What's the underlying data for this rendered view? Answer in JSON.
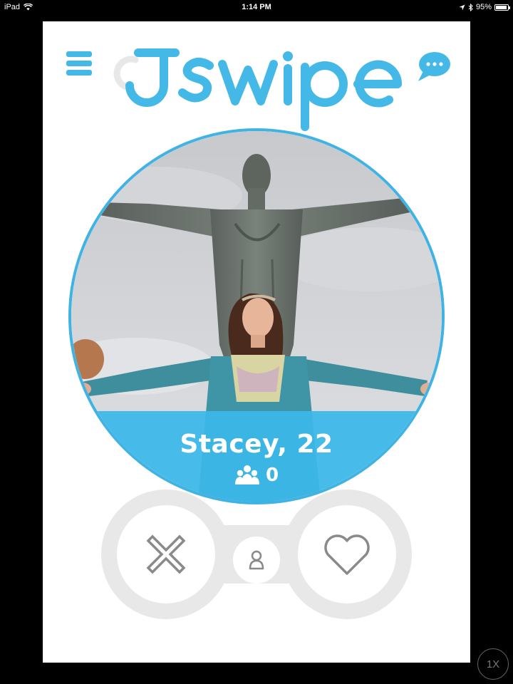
{
  "status_bar": {
    "device": "iPad",
    "time": "1:14 PM",
    "battery": "95%"
  },
  "header": {
    "logo_text": "Jswipe",
    "menu_icon": "hamburger-menu-icon",
    "chat_icon": "chat-bubble-icon"
  },
  "profile": {
    "name_age": "Stacey, 22",
    "mutual_friends_count": "0",
    "mutual_friends_icon": "group-icon"
  },
  "actions": {
    "nope_icon": "x-icon",
    "profile_icon": "person-icon",
    "like_icon": "heart-icon"
  },
  "compat_button": {
    "label": "1X"
  },
  "colors": {
    "brand": "#44b8e6",
    "band": "#3ab7e9",
    "button_track": "#e8e8e8",
    "icon_gray": "#8a8a8a"
  }
}
